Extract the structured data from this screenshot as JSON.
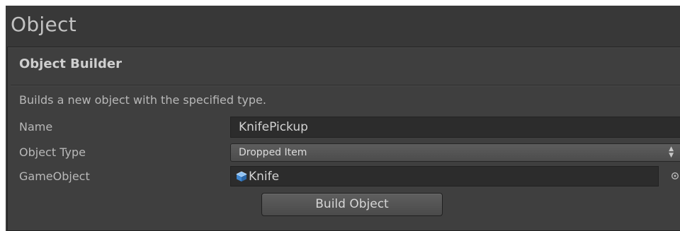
{
  "window": {
    "title": "Object"
  },
  "builder": {
    "section_title": "Object Builder",
    "description": "Builds a new object with the specified type.",
    "fields": {
      "name": {
        "label": "Name",
        "value": "KnifePickup"
      },
      "object_type": {
        "label": "Object Type",
        "selected": "Dropped Item"
      },
      "game_object": {
        "label": "GameObject",
        "value": "Knife",
        "icon": "prefab-cube-icon"
      }
    },
    "build_button": "Build Object"
  },
  "colors": {
    "window_bg": "#383838",
    "panel_bg": "#3f3f3f",
    "field_bg": "#2c2c2c",
    "text": "#b8b8b8",
    "cube_icon": "#4a90d9"
  }
}
